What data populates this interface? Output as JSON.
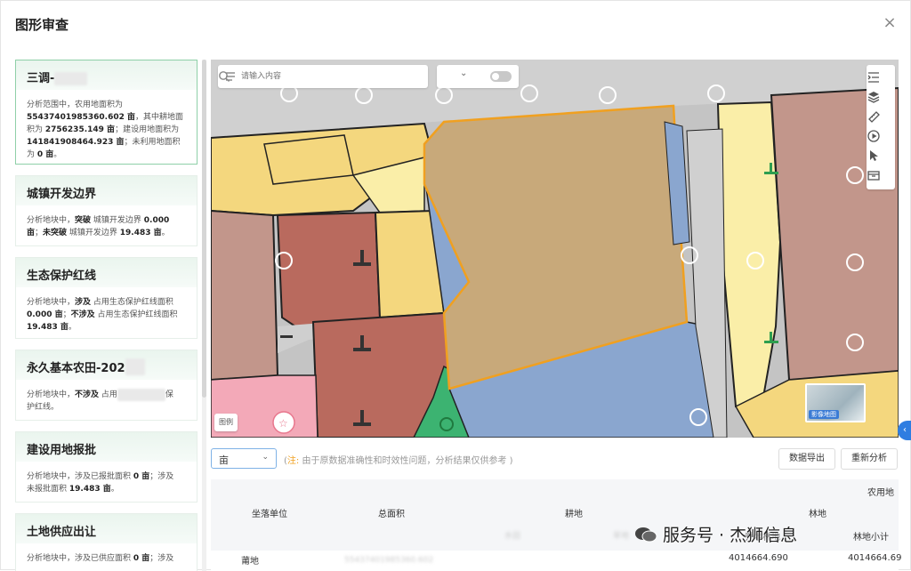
{
  "dialog": {
    "title": "图形审查",
    "close_label": "×"
  },
  "cards": [
    {
      "title": "三调-",
      "lines": [
        [
          "分析范围中，农用地面积为"
        ],
        [
          "B:55437401985360.602 亩",
          "，其中耕地面"
        ],
        [
          "积为 ",
          "B:2756235.149 亩",
          "；建设用地面积为"
        ],
        [
          "B:141841908464.923 亩",
          "；未利用地面积"
        ],
        [
          "为 ",
          "B:0 亩",
          "。"
        ]
      ]
    },
    {
      "title": "城镇开发边界",
      "lines": [
        [
          "分析地块中，",
          "B:突破",
          " 城镇开发边界 ",
          "B:0.000"
        ],
        [
          "B:亩",
          "；",
          "B:未突破",
          " 城镇开发边界 ",
          "B:19.483 亩",
          "。"
        ]
      ]
    },
    {
      "title": "生态保护红线",
      "lines": [
        [
          "分析地块中，",
          "B:涉及",
          " 占用生态保护红线面积"
        ],
        [
          "B:0.000 亩",
          "；",
          "B:不涉及",
          " 占用生态保护红线面积"
        ],
        [
          "B:19.483 亩",
          "。"
        ]
      ]
    },
    {
      "title": "永久基本农田-202",
      "lines": [
        [
          "分析地块中，",
          "B:不涉及",
          " 占用",
          "Z:永久基本农田",
          "保"
        ],
        [
          "护红线。"
        ]
      ]
    },
    {
      "title": "建设用地报批",
      "lines": [
        [
          "分析地块中，涉及已报批面积 ",
          "B:0 亩",
          "；涉及"
        ],
        [
          "未报批面积 ",
          "B:19.483 亩",
          "。"
        ]
      ]
    },
    {
      "title": "土地供应出让",
      "lines": [
        [
          "分析地块中，涉及已供应面积 ",
          "B:0 亩",
          "；涉及"
        ]
      ]
    }
  ],
  "map": {
    "search_placeholder": "请输入内容",
    "legend_label": "图例",
    "basemap_label": "影像地图",
    "toolbar": [
      "list-icon",
      "layers-icon",
      "ruler-icon",
      "play-icon",
      "pointer-icon",
      "box-icon"
    ],
    "colors": {
      "selected_parcel": "#c8a97a",
      "selected_outline": "#f0a020",
      "yellow": "#f4d77e",
      "light_yellow": "#faeea8",
      "brown": "#b96a5e",
      "mauve": "#c2968b",
      "blue": "#8aa6cf",
      "pink": "#f3a9b8",
      "green": "#3cb371",
      "grey": "#c4c4c4"
    }
  },
  "bottom": {
    "unit_value": "亩",
    "note_prefix": "注:",
    "note_text": " 由于原数据准确性和时效性问题，分析结果仅供参考 )",
    "export_label": "数据导出",
    "reanalyze_label": "重新分析"
  },
  "table": {
    "group_header": "农用地",
    "headers": [
      "坐落单位",
      "总面积",
      "耕地",
      "林地"
    ],
    "sub_header_right": "林地小计",
    "sub_header_mid": "乔木林地",
    "row_first": "莆地",
    "row_val1": "4014664.690",
    "row_val2": "4014664.69"
  },
  "watermark": "服务号 · 杰狮信息"
}
